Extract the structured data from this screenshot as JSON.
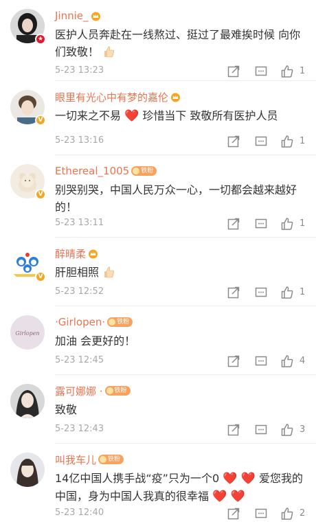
{
  "comments": [
    {
      "name": "Jinnie_",
      "fan": "",
      "text": "医护人员奔赴在一线熬过、挺过了最难挨时候 向你们致敬！",
      "emoji": "thumb",
      "time": "5-23 13:23",
      "likes": "1",
      "badge": "red",
      "avatar": "dark"
    },
    {
      "name": "眼里有光心中有梦的嘉伦",
      "fan": "",
      "text_a": "一切来之不易 ",
      "heart": "❤️",
      "text_b": " 珍惜当下 致敬所有医护人员",
      "time": "5-23 13:16",
      "likes": "1",
      "badge": "gold",
      "avatar": "boy"
    },
    {
      "name": "Ethereal_1005",
      "fan": "铁粉",
      "text": "别哭别哭，中国人民万众一心，一切都会越来越好的！",
      "time": "5-23 13:11",
      "likes": "1",
      "badge": "gold",
      "avatar": "bear"
    },
    {
      "name": "醉晴柔",
      "fan": "",
      "text": "肝胆相照 ",
      "emoji": "thumb",
      "time": "5-23 12:52",
      "likes": "1",
      "badge": "gold",
      "avatar": "cartoon"
    },
    {
      "name": "·Girlopen·",
      "fan": "铁粉",
      "text": "加油 会更好的！",
      "time": "5-23 12:45",
      "likes": "4",
      "badge": "gold",
      "avatar": "text",
      "avatar_text": "Girlopen"
    },
    {
      "name": "露可娜娜 ·",
      "fan": "铁粉",
      "text": "致敬",
      "time": "5-23 12:43",
      "likes": "3",
      "badge": "gold",
      "avatar": "girl"
    },
    {
      "name": "叫我车儿",
      "fan": "铁粉",
      "text_a": "14亿中国人携手战“疫”只为一个0 ",
      "heart": "❤️ ❤️",
      "text_b": " 爱您我的中国，身为中国人我真的很幸福 ",
      "heart2": "❤️ ❤️",
      "time": "5-23 12:40",
      "likes": "2",
      "badge": "",
      "avatar": "girl2"
    }
  ],
  "colors": {
    "name": "#eb7350",
    "text": "#333333",
    "time": "#a8a8a8",
    "heart": "#e43b3b"
  }
}
